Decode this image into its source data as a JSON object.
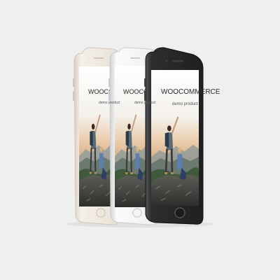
{
  "scene": {
    "background": "#efeff0",
    "subject": "three-smartphones-mockup"
  },
  "screen_content": {
    "brand_prefix": "WOOC",
    "brand_suffix": "OMMERCE",
    "tagline": "demo product"
  },
  "phones": [
    {
      "finish": "gold",
      "body_color": "#ece5da",
      "edge_color": "#cfc6b8"
    },
    {
      "finish": "silver",
      "body_color": "#f3f3f4",
      "edge_color": "#c9cacd"
    },
    {
      "finish": "space-gray",
      "body_color": "#2b2c2e",
      "edge_color": "#0f1011"
    }
  ]
}
